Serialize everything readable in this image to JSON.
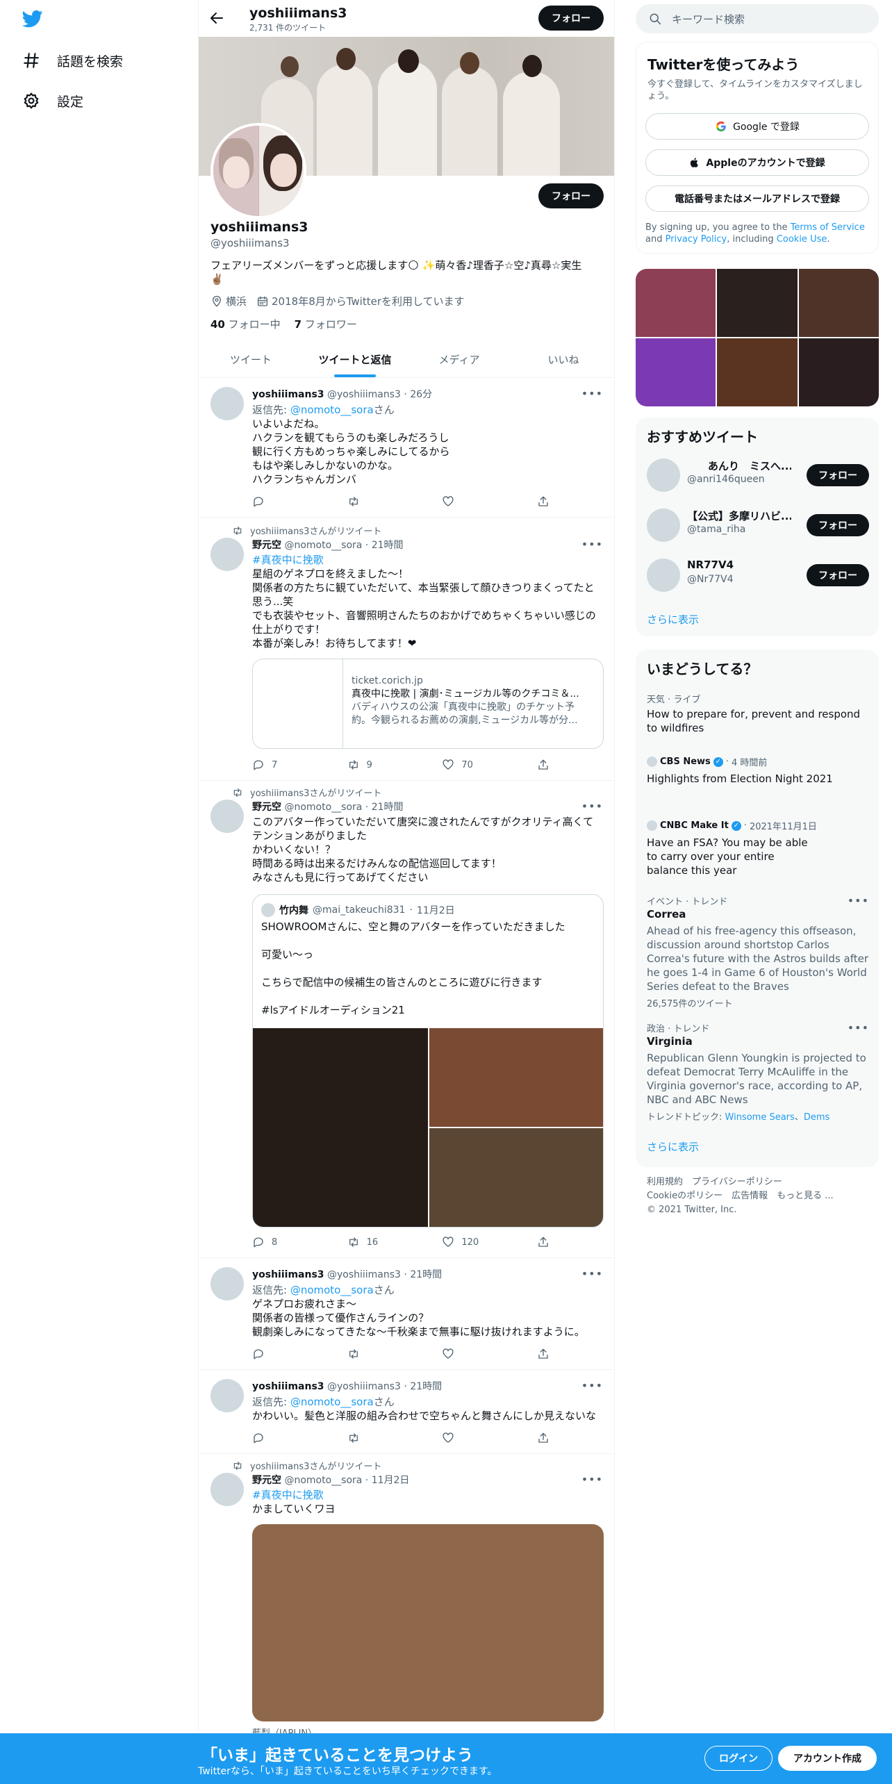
{
  "nav": {
    "explore": "話題を検索",
    "settings": "設定"
  },
  "header": {
    "name": "yoshiiimans3",
    "tweet_count": "2,731 件のツイート",
    "follow": "フォロー"
  },
  "profile": {
    "name": "yoshiiimans3",
    "handle": "@yoshiiimans3",
    "bio_line1": "フェアリーズメンバーをずっと応援します🌕 ✨萌々香♪理香子☆空♪真尋☆実生",
    "bio_line2": "✌🏽",
    "location": "横浜",
    "joined": "2018年8月からTwitterを利用しています",
    "following_count": "40",
    "following_label": "フォロー中",
    "followers_count": "7",
    "followers_label": "フォロワー",
    "follow": "フォロー"
  },
  "tabs": [
    "ツイート",
    "ツイートと返信",
    "メディア",
    "いいね"
  ],
  "tweets": [
    {
      "name": "yoshiiimans3",
      "handle": "@yoshiiimans3",
      "time": "26分",
      "reply_prefix": "返信先: ",
      "reply_to": "@nomoto__sora",
      "reply_suffix": "さん",
      "lines": [
        "いよいよだね。",
        "ハクランを観てもらうのも楽しみだろうし",
        "観に行く方もめっちゃ楽しみにしてるから",
        "もはや楽しみしかないのかな。",
        "ハクランちゃんガンバ"
      ]
    },
    {
      "retweeted_by": "yoshiiimans3さんがリツイート",
      "name": "野元空",
      "handle": "@nomoto__sora",
      "time": "21時間",
      "hashtag": "#真夜中に挽歌",
      "lines": [
        "星組のゲネプロを終えました〜！",
        "関係者の方たちに観ていただいて、本当緊張して顔ひきつりまくってたと",
        "思う...笑",
        "でも衣装やセット、音響照明さんたちのおかげでめちゃくちゃいい感じの",
        "仕上がりです！",
        "本番が楽しみ！お待ちしてます！❤"
      ],
      "card": {
        "domain": "ticket.corich.jp",
        "title": "真夜中に挽歌 | 演劇･ミュージカル等のクチコミ＆...",
        "desc1": "バディハウスの公演「真夜中に挽歌」のチケット予",
        "desc2": "約。今観られるお薦めの演劇,ミュージカル等が分..."
      },
      "replies": "7",
      "retweets": "9",
      "likes": "70"
    },
    {
      "retweeted_by": "yoshiiimans3さんがリツイート",
      "name": "野元空",
      "handle": "@nomoto__sora",
      "time": "21時間",
      "lines": [
        "このアバター作っていただいて唐突に渡されたんですがクオリティ高くて",
        "テンションあがりました",
        "かわいくない！？",
        "時間ある時は出来るだけみんなの配信巡回してます！",
        "みなさんも見に行ってあげてください"
      ],
      "quote": {
        "name": "竹内舞",
        "handle": "@mai_takeuchi831",
        "time": "11月2日",
        "lines": [
          "SHOWROOMさんに、空と舞のアバターを作っていただきました",
          "",
          "可愛い〜っ",
          "",
          "こちらで配信中の候補生の皆さんのところに遊びに行きます",
          "",
          "#lsアイドルオーディション21"
        ]
      },
      "replies": "8",
      "retweets": "16",
      "likes": "120"
    },
    {
      "name": "yoshiiimans3",
      "handle": "@yoshiiimans3",
      "time": "21時間",
      "reply_prefix": "返信先: ",
      "reply_to": "@nomoto__sora",
      "reply_suffix": "さん",
      "lines": [
        "ゲネプロお疲れさま〜",
        "関係者の皆様って優作さんラインの？",
        "観劇楽しみになってきたな〜千秋楽まで無事に駆け抜けれますように。"
      ]
    },
    {
      "name": "yoshiiimans3",
      "handle": "@yoshiiimans3",
      "time": "21時間",
      "reply_prefix": "返信先: ",
      "reply_to": "@nomoto__sora",
      "reply_suffix": "さん",
      "lines": [
        "かわいい。髪色と洋服の組み合わせで空ちゃんと舞さんにしか見えないな"
      ]
    },
    {
      "retweeted_by": "yoshiiimans3さんがリツイート",
      "name": "野元空",
      "handle": "@nomoto__sora",
      "time": "11月2日",
      "hashtag": "#真夜中に挽歌",
      "lines": [
        "かましていくワヨ"
      ],
      "caption": "藍梨（JAPLIN）"
    }
  ],
  "search": {
    "placeholder": "キーワード検索"
  },
  "signup": {
    "title": "Twitterを使ってみよう",
    "subtitle": "今すぐ登録して、タイムラインをカスタマイズしましょう。",
    "google": "Google で登録",
    "apple": "Appleのアカウントで登録",
    "phone": "電話番号またはメールアドレスで登録",
    "legal_pre": "By signing up, you agree to the ",
    "tos": "Terms of Service",
    "and": " and ",
    "privacy": "Privacy Policy",
    "including": ", including ",
    "cookie": "Cookie Use",
    "period": "."
  },
  "suggested": {
    "title": "おすすめツイート",
    "users": [
      {
        "name": "　　あんり　ミスへ...",
        "handle": "@anri146queen",
        "button": "フォロー"
      },
      {
        "name": "【公式】多摩リハビ...",
        "handle": "@tama_riha",
        "button": "フォロー"
      },
      {
        "name": "NR77V4",
        "handle": "@Nr77V4",
        "button": "フォロー"
      }
    ],
    "more": "さらに表示"
  },
  "trends": {
    "title": "いまどうしてる？",
    "items": [
      {
        "category": "天気 · ライブ",
        "title": "How to prepare for, prevent and respond to wildfires"
      },
      {
        "source": "CBS News",
        "time": "4 時間前",
        "title": "Highlights from Election Night 2021"
      },
      {
        "source": "CNBC Make It",
        "time": "2021年11月1日",
        "title": "Have an FSA? You may be able to carry over your entire balance this year"
      },
      {
        "category": "イベント · トレンド",
        "name": "Correa",
        "desc": "Ahead of his free-agency this offseason, discussion around shortstop Carlos Correa's future with the Astros builds after he goes 1-4 in Game 6 of Houston's World Series defeat to the Braves",
        "count": "26,575件のツイート"
      },
      {
        "category": "政治 · トレンド",
        "name": "Virginia",
        "desc": "Republican Glenn Youngkin is projected to defeat Democrat Terry McAuliffe in the Virginia governor's race, according to AP, NBC and ABC News",
        "topics_label": "トレンドトピック: ",
        "topic1": "Winsome Sears",
        "sep": "、",
        "topic2": "Dems"
      }
    ],
    "more": "さらに表示"
  },
  "footer": {
    "line1": "利用規約　プライバシーポリシー",
    "line2": "Cookieのポリシー　広告情報　もっと見る ...",
    "line3": "© 2021 Twitter, Inc."
  },
  "bottom": {
    "title": "「いま」起きていることを見つけよう",
    "subtitle": "Twitterなら、「いま」起きていることをいち早くチェックできます。",
    "login": "ログイン",
    "signup": "アカウント作成"
  }
}
